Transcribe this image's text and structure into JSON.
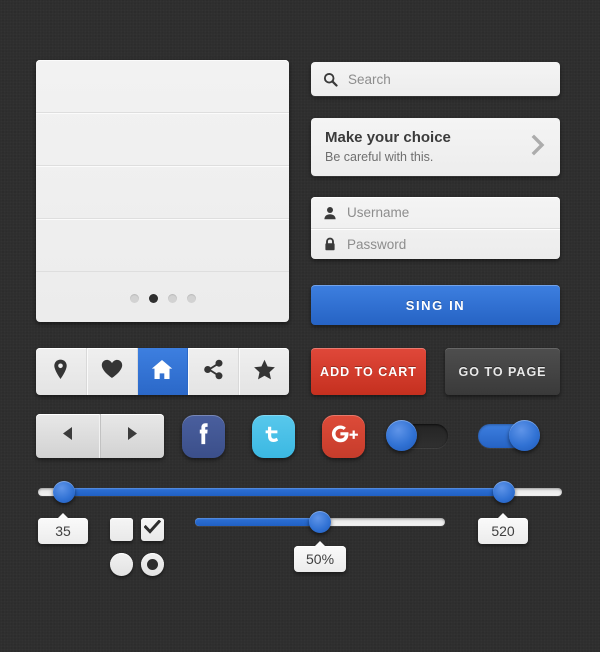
{
  "theme": {
    "background": "#2e2e2e",
    "accent_blue": "#2f6fd0",
    "accent_red": "#c5301f",
    "surface_light": "#f0f0f0"
  },
  "list_panel": {
    "rows": [
      "",
      "",
      "",
      ""
    ],
    "carousel": {
      "total": 4,
      "active_index": 1
    }
  },
  "search": {
    "icon": "search-icon",
    "placeholder": "Search",
    "value": ""
  },
  "choice_panel": {
    "icon": "chevron-right-icon",
    "title": "Make your choice",
    "subtitle": "Be careful with this."
  },
  "credentials": {
    "username": {
      "icon": "user-icon",
      "placeholder": "Username",
      "value": ""
    },
    "password": {
      "icon": "lock-icon",
      "placeholder": "Password",
      "value": ""
    }
  },
  "signin": {
    "label": "SING IN"
  },
  "icon_toolbar": {
    "items": [
      {
        "icon": "location-pin-icon",
        "name": "location",
        "active": false
      },
      {
        "icon": "heart-icon",
        "name": "favorite",
        "active": false
      },
      {
        "icon": "home-icon",
        "name": "home",
        "active": true
      },
      {
        "icon": "share-icon",
        "name": "share",
        "active": false
      },
      {
        "icon": "star-icon",
        "name": "star",
        "active": false
      }
    ]
  },
  "cta": {
    "add_to_cart": "ADD TO CART",
    "go_to_page": "GO TO PAGE"
  },
  "pager": {
    "prev_icon": "triangle-left-icon",
    "next_icon": "triangle-right-icon"
  },
  "social": [
    {
      "name": "facebook",
      "glyph": "f",
      "color": "#3b4f8a"
    },
    {
      "name": "twitter",
      "glyph": "t",
      "color": "#3bb8e2"
    },
    {
      "name": "googleplus",
      "glyph": "g+",
      "color": "#c63c2b"
    }
  ],
  "toggles": [
    {
      "name": "toggle-off",
      "state": "off"
    },
    {
      "name": "toggle-on",
      "state": "on"
    }
  ],
  "range_slider": {
    "min_value": "35",
    "max_value": "520",
    "min_percent": 5,
    "max_percent": 89
  },
  "single_slider": {
    "value_label": "50%",
    "percent": 50
  },
  "checkboxes": [
    {
      "name": "checkbox-unchecked",
      "checked": false
    },
    {
      "name": "checkbox-checked",
      "checked": true,
      "glyph": "✔"
    }
  ],
  "radios": [
    {
      "name": "radio-unselected",
      "selected": false
    },
    {
      "name": "radio-selected",
      "selected": true
    }
  ]
}
